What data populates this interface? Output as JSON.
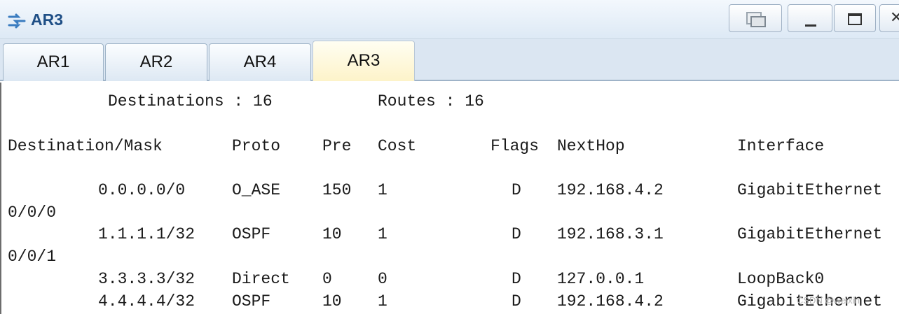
{
  "window": {
    "title": "AR3",
    "icon": "router-icon"
  },
  "tabs": [
    {
      "label": "AR1",
      "active": false
    },
    {
      "label": "AR2",
      "active": false
    },
    {
      "label": "AR4",
      "active": false
    },
    {
      "label": "AR3",
      "active": true
    }
  ],
  "terminal": {
    "summary": {
      "destinations_label": "Destinations : 16",
      "routes_label": "Routes : 16"
    },
    "headers": [
      "Destination/Mask",
      "Proto",
      "Pre",
      "Cost",
      "Flags",
      "NextHop",
      "Interface"
    ],
    "rows": [
      {
        "dest": "0.0.0.0/0",
        "proto": "O_ASE",
        "pre": "150",
        "cost": "1",
        "flags": "D",
        "nexthop": "192.168.4.2",
        "iface": "GigabitEthernet",
        "iface_cont": "0/0/0"
      },
      {
        "dest": "1.1.1.1/32",
        "proto": "OSPF",
        "pre": "10",
        "cost": "1",
        "flags": "D",
        "nexthop": "192.168.3.1",
        "iface": "GigabitEthernet",
        "iface_cont": "0/0/1"
      },
      {
        "dest": "3.3.3.3/32",
        "proto": "Direct",
        "pre": "0",
        "cost": "0",
        "flags": "D",
        "nexthop": "127.0.0.1",
        "iface": "LoopBack0",
        "iface_cont": ""
      },
      {
        "dest": "4.4.4.4/32",
        "proto": "OSPF",
        "pre": "10",
        "cost": "1",
        "flags": "D",
        "nexthop": "192.168.4.2",
        "iface": "GigabitEthernet",
        "iface_cont": ""
      }
    ],
    "watermark": "CSDN @weixin"
  }
}
